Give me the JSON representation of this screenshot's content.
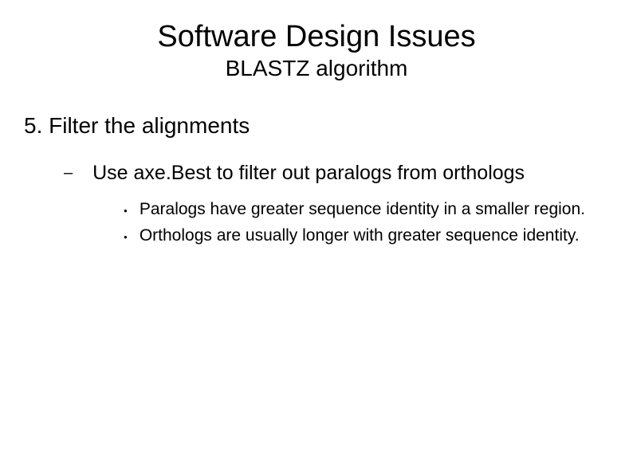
{
  "slide": {
    "title": "Software Design Issues",
    "subtitle": "BLASTZ algorithm",
    "section": "5. Filter the alignments",
    "level1_item": "Use axe.Best to filter out paralogs from orthologs",
    "level2_items": [
      "Paralogs have greater sequence identity in a smaller region.",
      "Orthologs are usually longer with greater sequence identity."
    ]
  }
}
